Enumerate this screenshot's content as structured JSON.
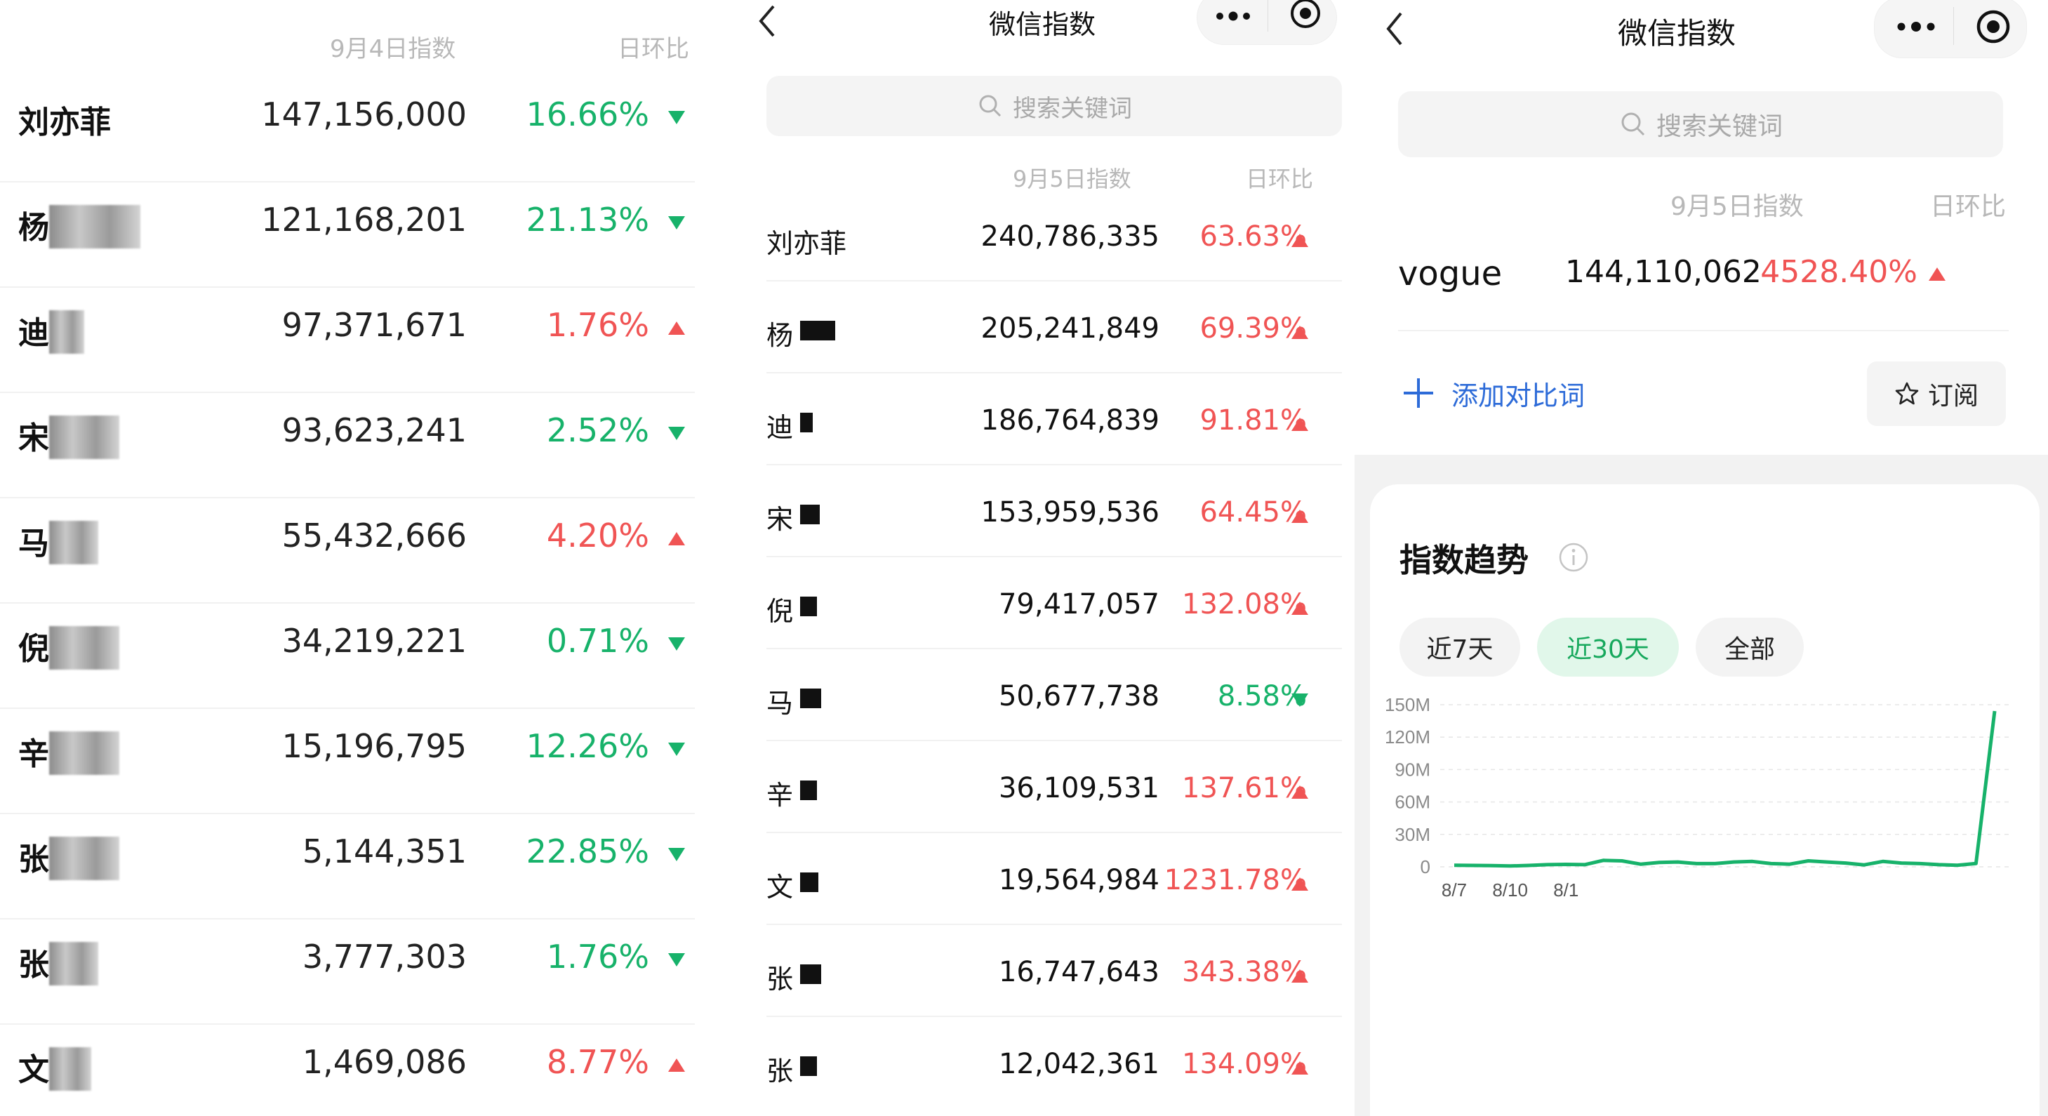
{
  "left_panel": {
    "date_header": "9月4日指数",
    "change_header": "日环比",
    "rows": [
      {
        "name": "刘亦菲",
        "value": "147,156,000",
        "change": "16.66%",
        "direction": "down"
      },
      {
        "name": "杨",
        "value": "121,168,201",
        "change": "21.13%",
        "direction": "down"
      },
      {
        "name": "迪",
        "value": "97,371,671",
        "change": "1.76%",
        "direction": "up"
      },
      {
        "name": "宋",
        "value": "93,623,241",
        "change": "2.52%",
        "direction": "down"
      },
      {
        "name": "马",
        "value": "55,432,666",
        "change": "4.20%",
        "direction": "up"
      },
      {
        "name": "倪",
        "value": "34,219,221",
        "change": "0.71%",
        "direction": "down"
      },
      {
        "name": "辛",
        "value": "15,196,795",
        "change": "12.26%",
        "direction": "down"
      },
      {
        "name": "张",
        "value": "5,144,351",
        "change": "22.85%",
        "direction": "down"
      },
      {
        "name": "张",
        "value": "3,777,303",
        "change": "1.76%",
        "direction": "down"
      },
      {
        "name": "文",
        "value": "1,469,086",
        "change": "8.77%",
        "direction": "up"
      }
    ]
  },
  "middle_panel": {
    "title": "微信指数",
    "search_placeholder": "搜索关键词",
    "date_header": "9月5日指数",
    "change_header": "日环比",
    "rows": [
      {
        "name": "刘亦菲",
        "value": "240,786,335",
        "change": "63.63%",
        "direction": "up"
      },
      {
        "name": "杨",
        "value": "205,241,849",
        "change": "69.39%",
        "direction": "up"
      },
      {
        "name": "迪",
        "value": "186,764,839",
        "change": "91.81%",
        "direction": "up"
      },
      {
        "name": "宋",
        "value": "153,959,536",
        "change": "64.45%",
        "direction": "up"
      },
      {
        "name": "倪",
        "value": "79,417,057",
        "change": "132.08%",
        "direction": "up"
      },
      {
        "name": "马",
        "value": "50,677,738",
        "change": "8.58%",
        "direction": "down"
      },
      {
        "name": "辛",
        "value": "36,109,531",
        "change": "137.61%",
        "direction": "up"
      },
      {
        "name": "文",
        "value": "19,564,984",
        "change": "1231.78%",
        "direction": "up"
      },
      {
        "name": "张",
        "value": "16,747,643",
        "change": "343.38%",
        "direction": "up"
      },
      {
        "name": "张",
        "value": "12,042,361",
        "change": "134.09%",
        "direction": "up"
      }
    ]
  },
  "right_panel": {
    "title": "微信指数",
    "search_placeholder": "搜索关键词",
    "date_header": "9月5日指数",
    "change_header": "日环比",
    "keyword": {
      "name": "vogue",
      "value": "144,110,062",
      "change": "4528.40%",
      "direction": "up"
    },
    "add_compare_label": "添加对比词",
    "subscribe_label": "订阅",
    "trend_title": "指数趋势",
    "range_chips": [
      "近7天",
      "近30天",
      "全部"
    ],
    "active_chip": "近30天",
    "chart_data": {
      "type": "line",
      "y_tick_labels": [
        "150M",
        "120M",
        "90M",
        "60M",
        "30M",
        "0"
      ],
      "x_tick_labels": [
        "8/7",
        "8/10",
        "8/1"
      ],
      "ylim": [
        0,
        150000000
      ],
      "series_color": "#17b26a",
      "series": [
        {
          "x": [
            "8/7",
            "8/8",
            "8/9",
            "8/10",
            "8/11",
            "8/12",
            "8/13",
            "8/14",
            "8/15",
            "8/16",
            "8/17",
            "8/18",
            "8/19",
            "8/20",
            "8/21",
            "8/22",
            "8/23",
            "8/24",
            "8/25",
            "8/26",
            "8/27",
            "8/28",
            "8/29",
            "8/30",
            "8/31",
            "9/1",
            "9/2",
            "9/3",
            "9/4",
            "9/5"
          ],
          "values": [
            1500000,
            1300000,
            1200000,
            800000,
            1300000,
            2000000,
            2300000,
            2000000,
            6000000,
            5500000,
            2500000,
            4000000,
            4500000,
            3000000,
            3000000,
            4500000,
            5000000,
            3000000,
            2500000,
            5500000,
            4500000,
            3500000,
            1800000,
            5000000,
            3500000,
            3000000,
            2000000,
            1500000,
            3100000,
            144110062
          ]
        }
      ]
    },
    "colors": {
      "accent": "#17b26a",
      "up": "#f05454",
      "down": "#17b26a",
      "link": "#2d6bd8"
    }
  }
}
